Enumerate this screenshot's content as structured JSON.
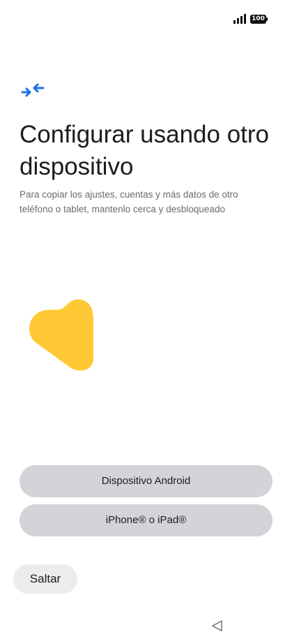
{
  "status_bar": {
    "signal_icon": "signal-bars-icon",
    "battery_level": "100"
  },
  "header": {
    "icon": "transfer-arrows-icon",
    "title": "Configurar usando otro dispositivo",
    "subtitle": "Para copiar los ajustes, cuentas y más datos de otro teléfono o tablet, mantenlo cerca y desbloqueado"
  },
  "illustration": {
    "icon": "yellow-blob-shape",
    "color": "#FFC935"
  },
  "options": {
    "android_label": "Dispositivo Android",
    "iphone_label": "iPhone® o iPad®"
  },
  "footer": {
    "skip_label": "Saltar"
  },
  "nav_bar": {
    "back_icon": "back-triangle-icon"
  },
  "colors": {
    "accent": "#1A73E8",
    "button_bg": "#D3D4D8",
    "skip_bg": "#ECECEE",
    "text_primary": "#1C1C1E",
    "text_secondary": "#6B6B70"
  }
}
